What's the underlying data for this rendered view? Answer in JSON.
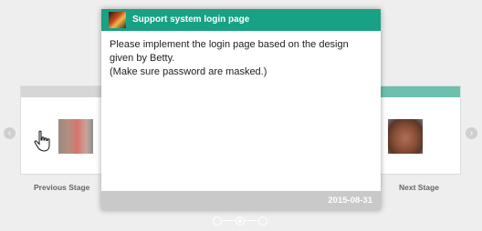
{
  "card": {
    "title": "Support system login page",
    "body_lines": [
      "Please implement the login page based on the design",
      "given by Betty.",
      "(Make sure password are masked.)"
    ],
    "date": "2015-08-31",
    "header_color": "#18a184"
  },
  "stages": {
    "previous_label": "Previous Stage",
    "next_label": "Next Stage"
  },
  "navigation": {
    "prev_icon": "chevron-left-icon",
    "next_icon": "chevron-right-icon",
    "pager_dots": 3,
    "active_dot": 2
  },
  "colors": {
    "accent": "#18a184",
    "next_stage_bar": "#6dbfae",
    "prev_stage_bar": "#d6d6d6",
    "footer": "#c9c9c9",
    "background": "#eeeeee"
  }
}
